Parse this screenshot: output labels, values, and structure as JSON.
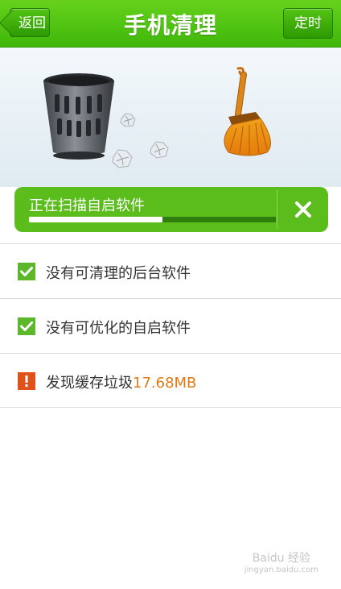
{
  "header": {
    "title": "手机清理",
    "back_label": "返回",
    "timer_label": "定时"
  },
  "scan": {
    "status": "正在扫描自启软件",
    "progress": 0.54,
    "cancel_icon": "close-icon"
  },
  "results": [
    {
      "icon": "check-icon",
      "text": "没有可清理的后台软件",
      "value": ""
    },
    {
      "icon": "check-icon",
      "text": "没有可优化的自启软件",
      "value": ""
    },
    {
      "icon": "warning-icon",
      "text": "发现缓存垃圾",
      "value": "17.68MB"
    }
  ],
  "watermark": {
    "logo": "Baidu 经验",
    "url": "jingyan.baidu.com"
  },
  "colors": {
    "header_green": "#44bb0e",
    "card_green": "#5bbd1c",
    "check_green": "#5cb82a",
    "warning_orange": "#e0521c",
    "value_orange": "#e47a16"
  }
}
